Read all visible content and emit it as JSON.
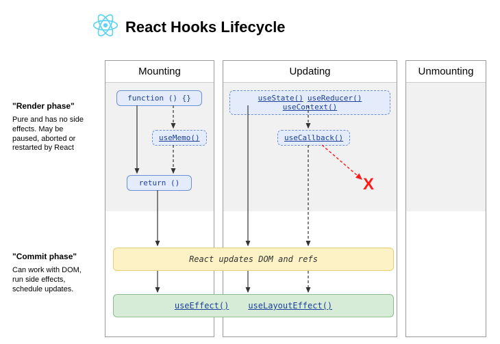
{
  "title": "React Hooks Lifecycle",
  "logo_name": "react-logo",
  "phases": {
    "render": {
      "heading": "\"Render phase\"",
      "desc": "Pure and has no side effects. May be paused, aborted or restarted by React"
    },
    "commit": {
      "heading": "\"Commit phase\"",
      "desc": "Can work with DOM, run side effects, schedule updates."
    }
  },
  "columns": {
    "mounting": "Mounting",
    "updating": "Updating",
    "unmounting": "Unmounting"
  },
  "nodes": {
    "func": "function () {}",
    "useMemo": "useMemo()",
    "ret": "return ()",
    "useState": "useState()",
    "useReducer": "useReducer()",
    "useContext": "useContext()",
    "useCallback": "useCallback()",
    "domBand": "React updates DOM and refs",
    "useEffect": "useEffect()",
    "useLayoutEffect": "useLayoutEffect()"
  },
  "x_mark": "X"
}
